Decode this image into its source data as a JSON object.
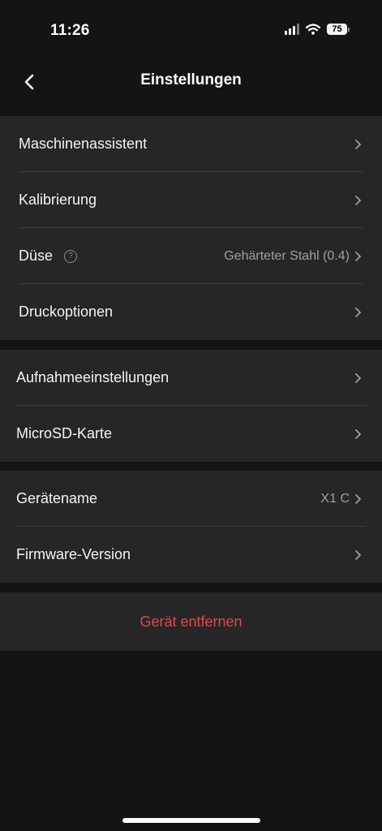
{
  "status_bar": {
    "time": "11:26",
    "battery": "75"
  },
  "header": {
    "title": "Einstellungen"
  },
  "groups": [
    {
      "items": [
        {
          "label": "Maschinenassistent"
        },
        {
          "label": "Kalibrierung"
        },
        {
          "label": "Düse",
          "value": "Gehärteter Stahl (0.4)"
        },
        {
          "label": "Druckoptionen"
        }
      ]
    },
    {
      "items": [
        {
          "label": "Aufnahmeeinstellungen"
        },
        {
          "label": "MicroSD-Karte"
        }
      ]
    },
    {
      "items": [
        {
          "label": "Gerätename",
          "value": "X1 C"
        },
        {
          "label": "Firmware-Version"
        }
      ]
    }
  ],
  "remove_device": {
    "label": "Gerät entfernen"
  },
  "colors": {
    "background": "#141414",
    "row_bg": "#262626",
    "danger": "#e2474b"
  }
}
